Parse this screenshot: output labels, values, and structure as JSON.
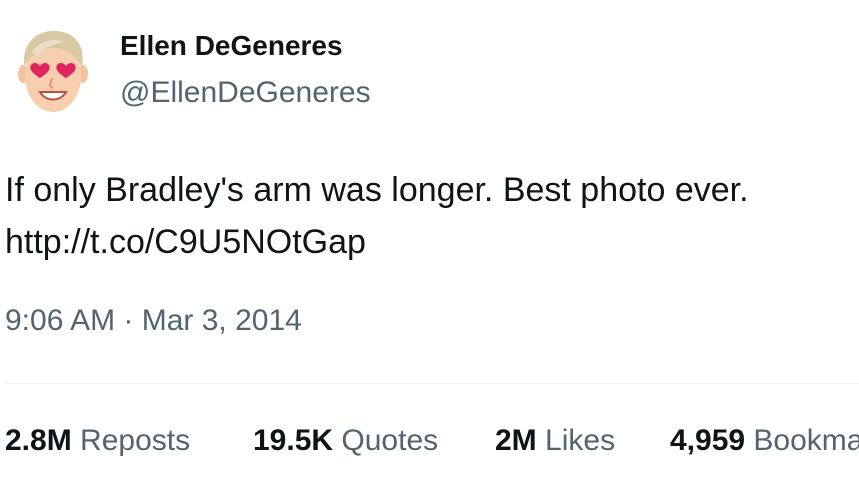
{
  "author": {
    "display_name": "Ellen DeGeneres",
    "handle": "@EllenDeGeneres",
    "avatar_icon": "heart-eyes-avatar-icon"
  },
  "tweet": {
    "lines": [
      "If only Bradley's arm was longer. Best photo ever.",
      "http://t.co/C9U5NOtGap"
    ],
    "timestamp": "9:06 AM · Mar 3, 2014"
  },
  "stats": [
    {
      "value": "2.8M",
      "label": "Reposts"
    },
    {
      "value": "19.5K",
      "label": "Quotes"
    },
    {
      "value": "2M",
      "label": "Likes"
    },
    {
      "value": "4,959",
      "label": "Bookmarks"
    }
  ],
  "colors": {
    "text": "#0f1419",
    "muted": "#536471",
    "divider": "#eff3f4",
    "link": "#0f1419"
  }
}
